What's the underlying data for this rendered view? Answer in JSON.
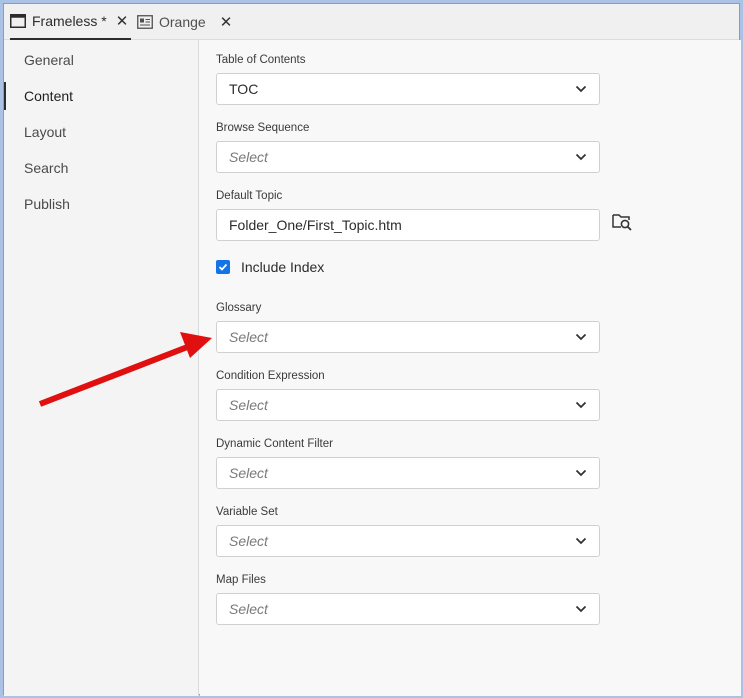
{
  "tabs": [
    {
      "label": "Frameless *",
      "icon": "window-icon",
      "active": true
    },
    {
      "label": "Orange",
      "icon": "skin-icon",
      "active": false
    }
  ],
  "sidebar": {
    "items": [
      {
        "label": "General"
      },
      {
        "label": "Content",
        "selected": true
      },
      {
        "label": "Layout"
      },
      {
        "label": "Search"
      },
      {
        "label": "Publish"
      }
    ]
  },
  "fields": {
    "toc": {
      "label": "Table of Contents",
      "value": "TOC"
    },
    "browse_sequence": {
      "label": "Browse Sequence",
      "placeholder": "Select"
    },
    "default_topic": {
      "label": "Default Topic",
      "value": "Folder_One/First_Topic.htm"
    },
    "include_index": {
      "label": "Include Index",
      "checked": true
    },
    "glossary": {
      "label": "Glossary",
      "placeholder": "Select"
    },
    "condition_expression": {
      "label": "Condition Expression",
      "placeholder": "Select"
    },
    "dynamic_content_filter": {
      "label": "Dynamic Content Filter",
      "placeholder": "Select"
    },
    "variable_set": {
      "label": "Variable Set",
      "placeholder": "Select"
    },
    "map_files": {
      "label": "Map Files",
      "placeholder": "Select"
    }
  },
  "colors": {
    "accent": "#1473e6",
    "annotation_arrow": "#e01010",
    "frame_border": "#a9c2e6"
  }
}
